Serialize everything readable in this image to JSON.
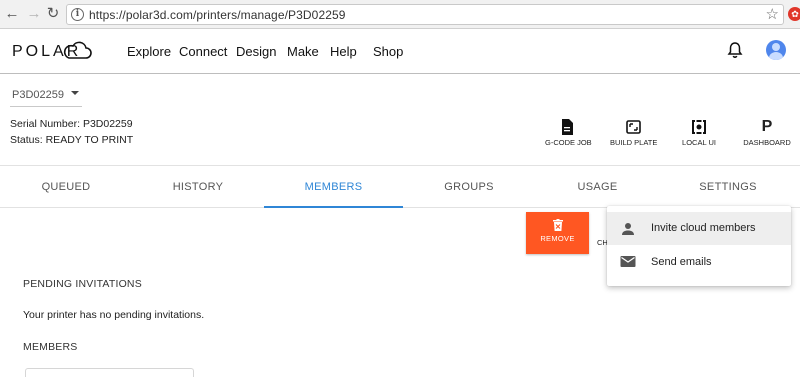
{
  "browser": {
    "url": "https://polar3d.com/printers/manage/P3D02259",
    "back_icon": "←",
    "forward_icon": "→",
    "reload_icon": "↻",
    "star_icon": "☆",
    "info_icon": "i"
  },
  "header": {
    "logo_text": "POLAR",
    "nav": [
      "Explore",
      "Connect",
      "Design",
      "Make",
      "Help",
      "Shop"
    ]
  },
  "printer": {
    "selected": "P3D02259",
    "serial_line": "Serial Number: P3D02259",
    "status_line": "Status: READY TO PRINT"
  },
  "tools": [
    {
      "label": "G-CODE JOB",
      "icon": "file-icon"
    },
    {
      "label": "BUILD PLATE",
      "icon": "build-plate-icon"
    },
    {
      "label": "LOCAL UI",
      "icon": "local-ui-icon"
    },
    {
      "label": "DASHBOARD",
      "icon": "dashboard-icon",
      "glyph": "P"
    }
  ],
  "tabs": [
    "QUEUED",
    "HISTORY",
    "MEMBERS",
    "GROUPS",
    "USAGE",
    "SETTINGS"
  ],
  "active_tab": "MEMBERS",
  "colors": {
    "accent": "#2f86d6",
    "remove": "#ff5722"
  },
  "content": {
    "remove_label": "REMOVE",
    "change_label": "CH",
    "pending_title": "PENDING INVITATIONS",
    "pending_empty": "Your printer has no pending invitations.",
    "members_title": "MEMBERS"
  },
  "menu": {
    "items": [
      {
        "label": "Invite cloud members",
        "icon": "person-icon"
      },
      {
        "label": "Send emails",
        "icon": "mail-icon"
      }
    ]
  }
}
